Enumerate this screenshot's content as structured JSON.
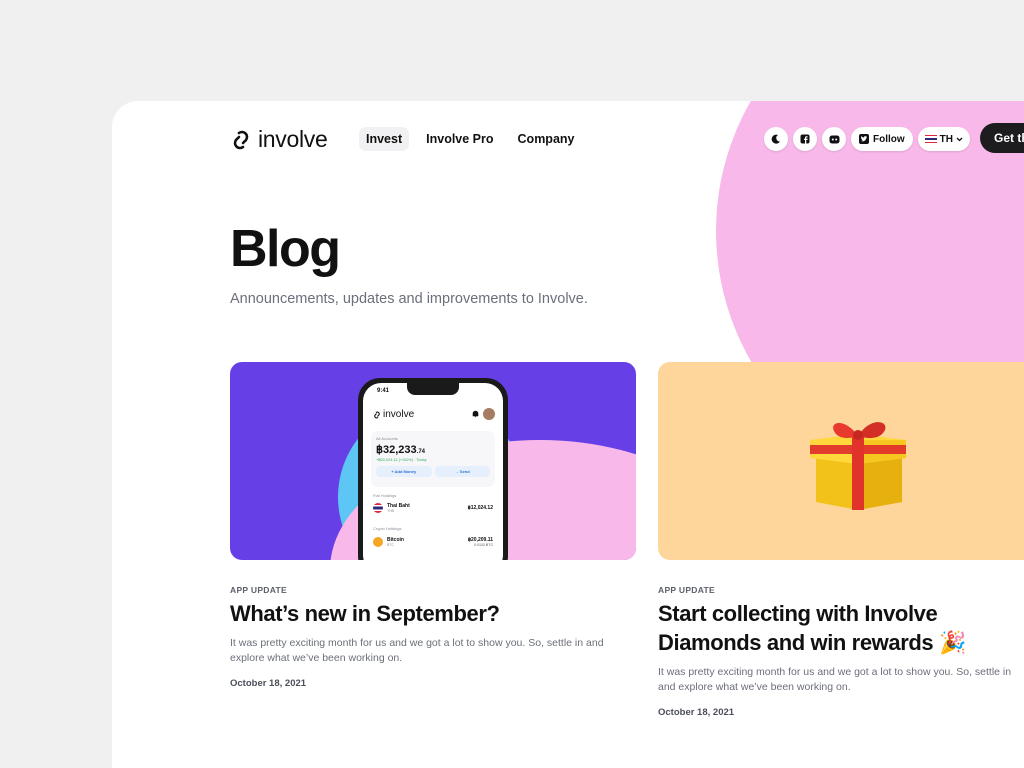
{
  "header": {
    "logo_text": "involve",
    "nav": [
      {
        "label": "Invest",
        "active": true
      },
      {
        "label": "Involve Pro",
        "active": false
      },
      {
        "label": "Company",
        "active": false
      }
    ],
    "follow_label": "Follow",
    "lang_label": "TH",
    "cta_label": "Get th"
  },
  "hero": {
    "title": "Blog",
    "subtitle": "Announcements, updates and improvements to Involve."
  },
  "posts": [
    {
      "category": "APP UPDATE",
      "title": "What’s new in September?",
      "description": "It was pretty exciting month for us and we got a lot to show you.  So, settle in and explore what we’ve been working on.",
      "date": "October 18, 2021",
      "phone": {
        "time": "9:41",
        "logo": "involve",
        "accounts_label": "All Accounts",
        "balance_main": "฿32,233",
        "balance_dec": ".74",
        "change": "+฿20,024.12 (+100%)  ·  Today",
        "add_money": "+ Add Money",
        "send": "→ Send",
        "fiat_label": "Fiat Holdings",
        "fiat_name": "Thai Baht",
        "fiat_code": "THB",
        "fiat_amount": "฿12,024.12",
        "crypto_label": "Crypto Holdings",
        "crypto_name": "Bitcoin",
        "crypto_code": "BTC",
        "crypto_amount": "฿20,209.11",
        "crypto_sub": "0.0132 BTC"
      }
    },
    {
      "category": "APP UPDATE",
      "title": "Start collecting with Involve Diamonds and win rewards 🎉",
      "description": "It was pretty exciting month for us and we got a lot to show you.  So, settle in and explore what we’ve been working on.",
      "date": "October 18, 2021"
    }
  ],
  "colors": {
    "accent_pink": "#f8b9ea",
    "card1_bg": "#6640e6",
    "card2_bg": "#fed59b",
    "cta_bg": "#1d1d1f"
  },
  "icons": [
    "link-logo-icon",
    "moon-icon",
    "facebook-icon",
    "discord-icon",
    "twitter-icon",
    "thai-flag-icon",
    "chevron-down-icon",
    "gift-icon"
  ]
}
